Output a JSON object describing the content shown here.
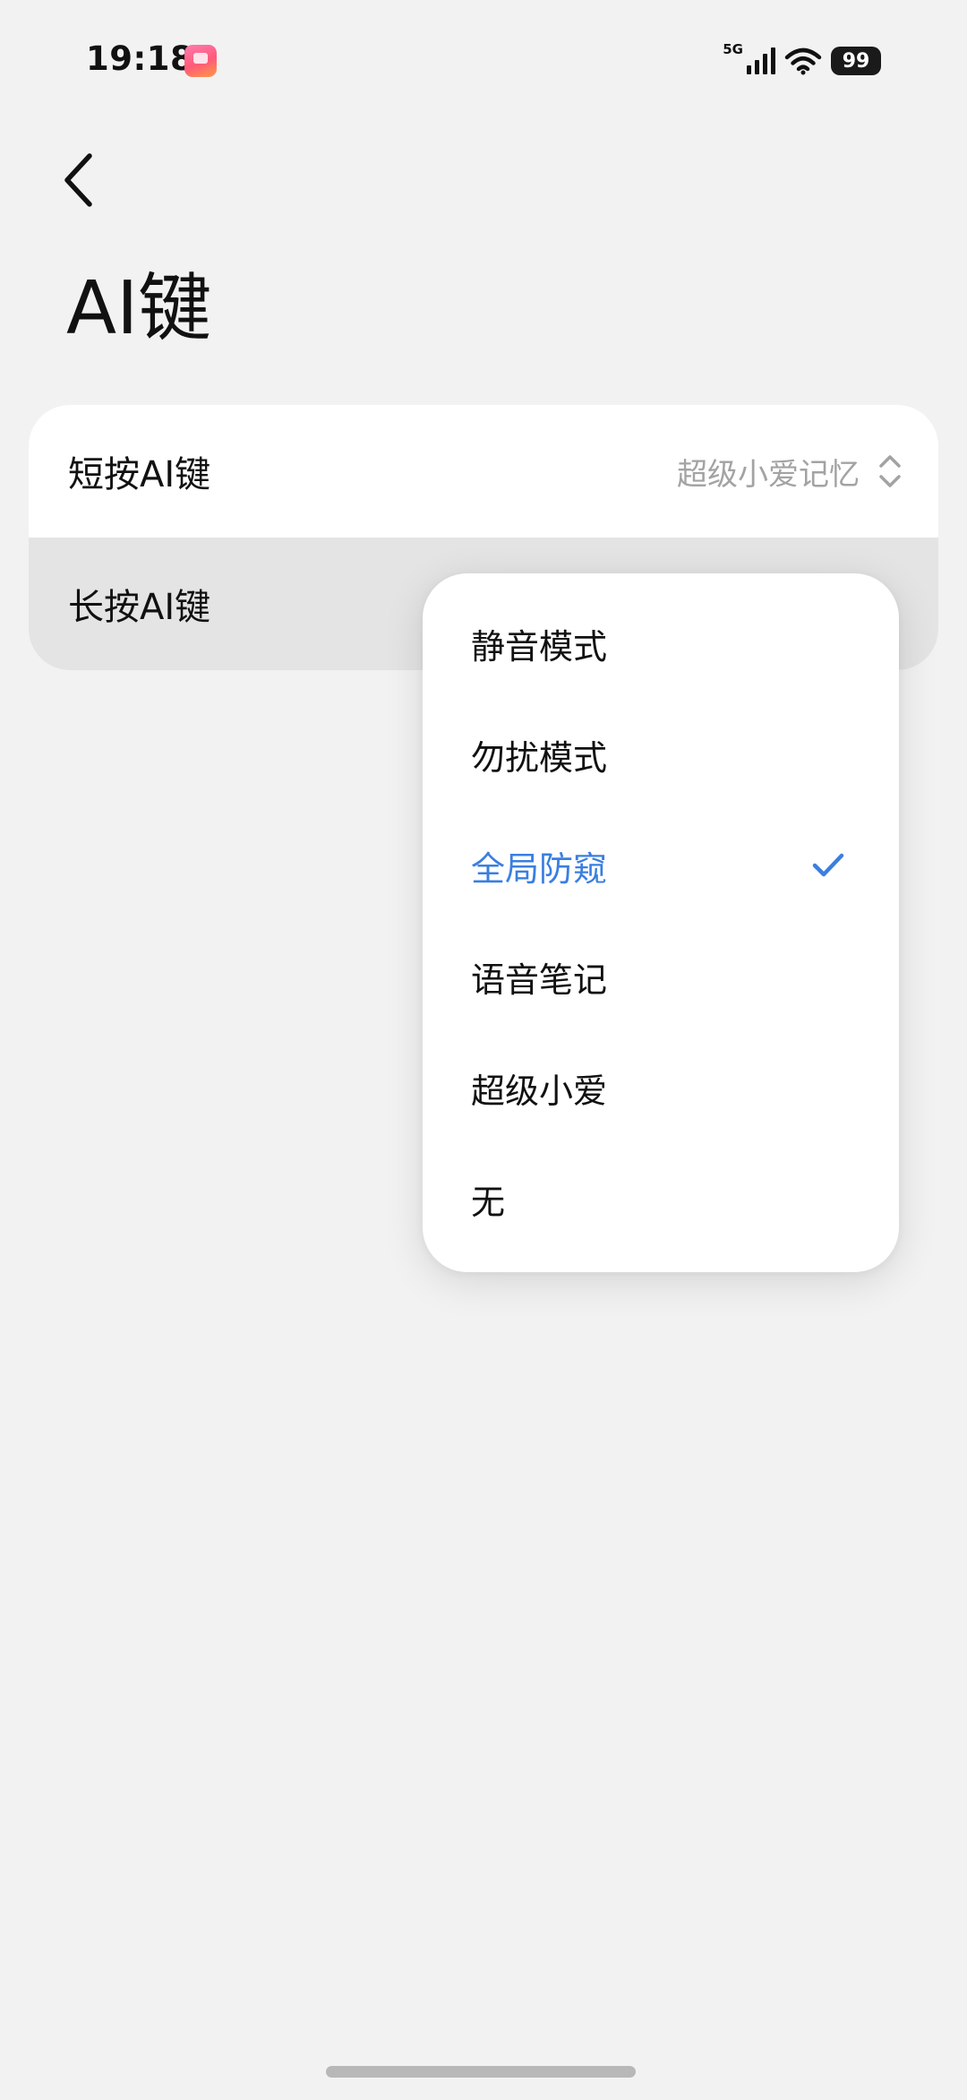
{
  "status_bar": {
    "time": "19:18",
    "network": "5G",
    "battery": "99",
    "notification_icon": "app-notification-icon",
    "icons": [
      "signal-icon",
      "wifi-icon",
      "battery-icon"
    ]
  },
  "header": {
    "back_icon": "chevron-left-icon",
    "title": "AI键"
  },
  "settings": {
    "short_press": {
      "label": "短按AI键",
      "value": "超级小爱记忆",
      "icon": "chevron-up-down-icon"
    },
    "long_press": {
      "label": "长按AI键"
    }
  },
  "dropdown": {
    "selected_index": 2,
    "check_icon": "checkmark-icon",
    "options": [
      "静音模式",
      "勿扰模式",
      "全局防窥",
      "语音笔记",
      "超级小爱",
      "无"
    ]
  },
  "colors": {
    "background": "#f2f2f2",
    "card": "#ffffff",
    "accent": "#3a7fe0",
    "secondary_text": "#a3a3a3",
    "pressed_row": "#e4e4e4"
  }
}
